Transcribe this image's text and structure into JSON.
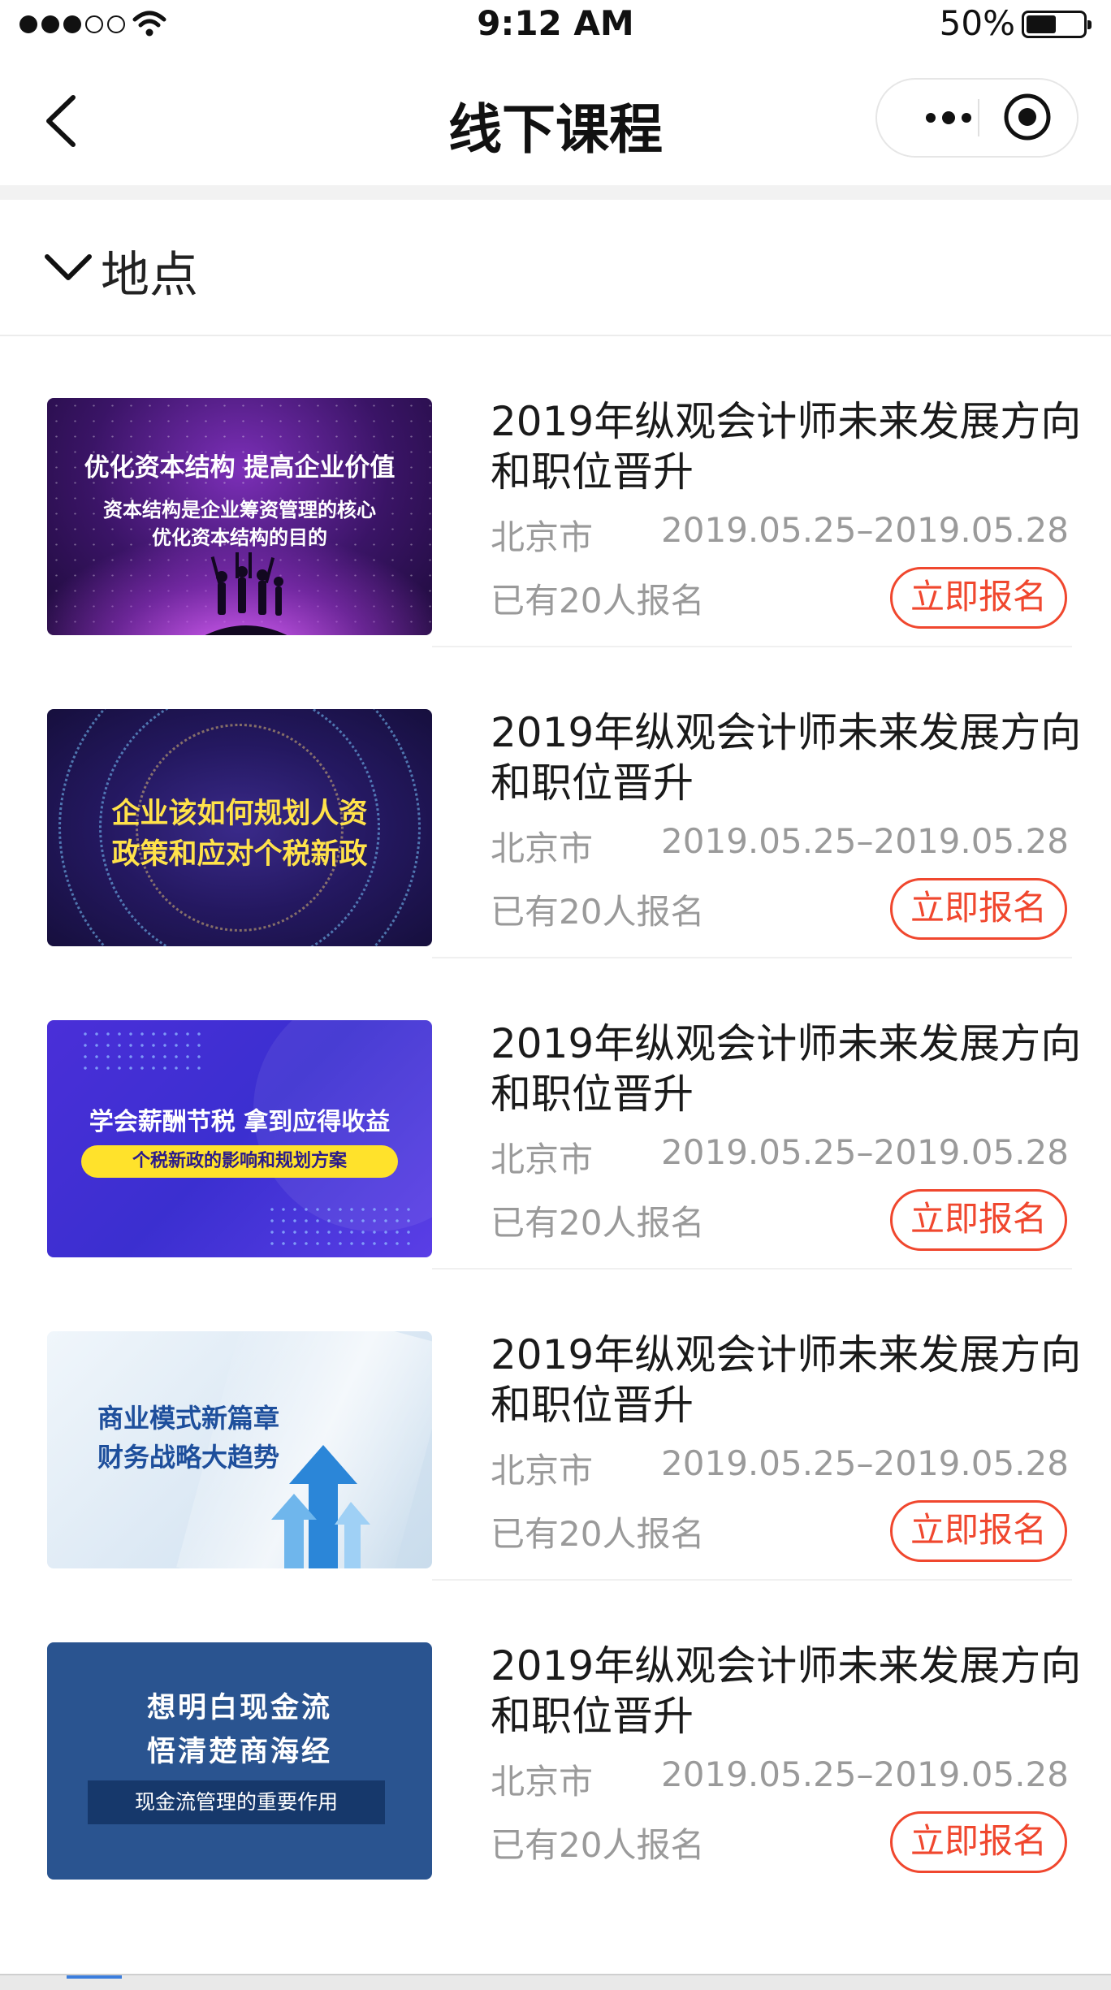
{
  "status_bar": {
    "time": "9:12 AM",
    "battery_percent": "50%",
    "signal_bars_filled": 3,
    "signal_bars_total": 5
  },
  "nav": {
    "title": "线下课程",
    "back_icon": "chevron-left-icon",
    "more_icon": "more-dots-icon",
    "close_icon": "target-circle-icon"
  },
  "filter": {
    "label": "地点",
    "icon": "chevron-down-icon"
  },
  "courses": [
    {
      "title": "2019年纵观会计师未来发展方向和职位晋升",
      "city": "北京市",
      "date": "2019.05.25–2019.05.28",
      "enrolled": "已有20人报名",
      "button": "立即报名",
      "thumb_lines": [
        "优化资本结构   提高企业价值",
        "资本结构是企业筹资管理的核心",
        "优化资本结构的目的"
      ]
    },
    {
      "title": "2019年纵观会计师未来发展方向和职位晋升",
      "city": "北京市",
      "date": "2019.05.25–2019.05.28",
      "enrolled": "已有20人报名",
      "button": "立即报名",
      "thumb_lines": [
        "企业该如何规划人资",
        "政策和应对个税新政"
      ]
    },
    {
      "title": "2019年纵观会计师未来发展方向和职位晋升",
      "city": "北京市",
      "date": "2019.05.25–2019.05.28",
      "enrolled": "已有20人报名",
      "button": "立即报名",
      "thumb_lines": [
        "学会薪酬节税   拿到应得收益",
        "个税新政的影响和规划方案"
      ]
    },
    {
      "title": "2019年纵观会计师未来发展方向和职位晋升",
      "city": "北京市",
      "date": "2019.05.25–2019.05.28",
      "enrolled": "已有20人报名",
      "button": "立即报名",
      "thumb_lines": [
        "商业模式新篇章",
        "财务战略大趋势"
      ]
    },
    {
      "title": "2019年纵观会计师未来发展方向和职位晋升",
      "city": "北京市",
      "date": "2019.05.25–2019.05.28",
      "enrolled": "已有20人报名",
      "button": "立即报名",
      "thumb_lines": [
        "想明白现金流",
        "悟清楚商海经",
        "现金流管理的重要作用"
      ]
    }
  ],
  "colors": {
    "accent": "#f0472e",
    "muted_text": "#9a9a9a",
    "title_text": "#1a1a1a"
  }
}
